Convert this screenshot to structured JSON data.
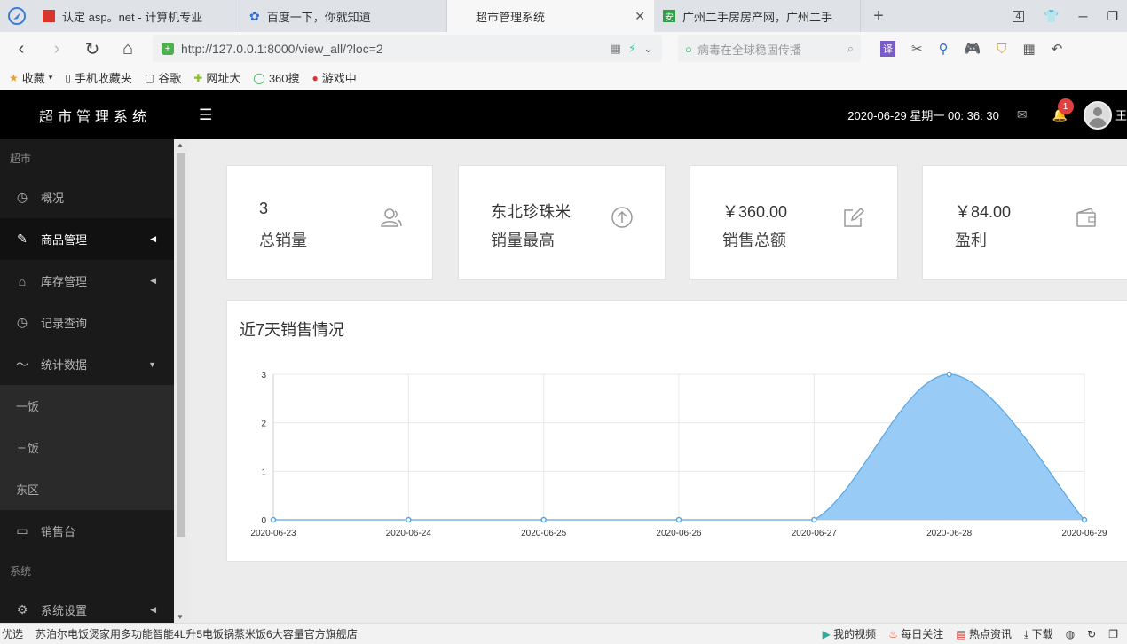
{
  "browser": {
    "tabs": [
      {
        "title": "认定 asp。net - 计算机专业",
        "active": false
      },
      {
        "title": "百度一下，你就知道",
        "active": false
      },
      {
        "title": "超市管理系统",
        "active": true
      },
      {
        "title": "广州二手房房产网，广州二手",
        "active": false
      }
    ],
    "tab_count": "4",
    "url": "http://127.0.0.1:8000/view_all/?loc=2",
    "search_placeholder": "病毒在全球稳固传播",
    "bookmarks": [
      "收藏",
      "手机收藏夹",
      "谷歌",
      "网址大",
      "360搜",
      "游戏中"
    ]
  },
  "app": {
    "brand": "超市管理系统",
    "datetime": "2020-06-29 星期一 00: 36: 30",
    "notification_count": "1",
    "user_initial": "王"
  },
  "sidebar": {
    "section1": "超市",
    "items": [
      {
        "label": "概况",
        "icon": "clock-icon"
      },
      {
        "label": "商品管理",
        "icon": "pencil-icon",
        "active": true
      },
      {
        "label": "库存管理",
        "icon": "home-icon"
      },
      {
        "label": "记录查询",
        "icon": "clock-icon"
      },
      {
        "label": "统计数据",
        "icon": "chart-icon"
      }
    ],
    "subitems": [
      "一饭",
      "三饭",
      "东区"
    ],
    "item_pos": {
      "label": "销售台",
      "icon": "monitor-icon"
    },
    "section2": "系统",
    "item_settings": {
      "label": "系统设置",
      "icon": "gear-icon"
    }
  },
  "cards": [
    {
      "value": "3",
      "label": "总销量",
      "icon": "users-icon"
    },
    {
      "value": "东北珍珠米",
      "label": "销量最高",
      "icon": "arrow-up-circle-icon"
    },
    {
      "value": "￥360.00",
      "label": "销售总额",
      "icon": "edit-icon"
    },
    {
      "value": "￥84.00",
      "label": "盈利",
      "icon": "wallet-icon"
    }
  ],
  "panel_title": "近7天销售情况",
  "chart_data": {
    "type": "area",
    "title": "近7天销售情况",
    "x": [
      "2020-06-23",
      "2020-06-24",
      "2020-06-25",
      "2020-06-26",
      "2020-06-27",
      "2020-06-28",
      "2020-06-29"
    ],
    "series": [
      {
        "values": [
          0,
          0,
          0,
          0,
          0,
          3,
          0
        ]
      }
    ],
    "ylim": [
      0,
      3
    ],
    "yticks": [
      0,
      1,
      2,
      3
    ],
    "grid": true,
    "colors": {
      "fill": "#92c8f5",
      "line": "#5aa6e0"
    }
  },
  "statusbar": {
    "left": "优选",
    "news": "苏泊尔电饭煲家用多功能智能4L升5电饭锅蒸米饭6大容量官方旗舰店",
    "links": [
      "我的视频",
      "每日关注",
      "热点资讯",
      "下载"
    ]
  }
}
